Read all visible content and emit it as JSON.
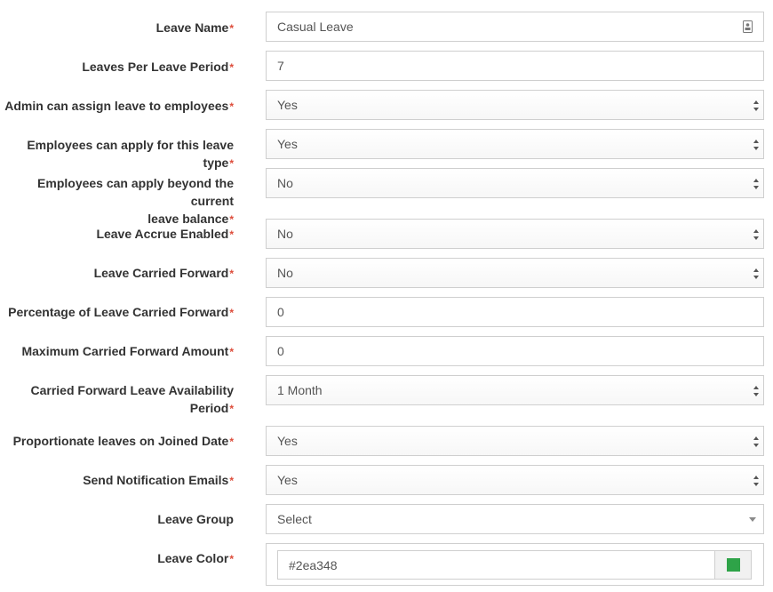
{
  "required_marker": "*",
  "fields": [
    {
      "label": "Leave Name",
      "value": "Casual Leave"
    },
    {
      "label": "Leaves Per Leave Period",
      "value": "7"
    },
    {
      "label": "Admin can assign leave to employees",
      "value": "Yes"
    },
    {
      "label": "Employees can apply for this leave type",
      "value": "Yes"
    },
    {
      "label_line1": "Employees can apply beyond the current",
      "label_line2": "leave balance",
      "value": "No"
    },
    {
      "label": "Leave Accrue Enabled",
      "value": "No"
    },
    {
      "label": "Leave Carried Forward",
      "value": "No"
    },
    {
      "label": "Percentage of Leave Carried Forward",
      "value": "0"
    },
    {
      "label": "Maximum Carried Forward Amount",
      "value": "0"
    },
    {
      "label_line1": "Carried Forward Leave Availability",
      "label_line2": "Period",
      "value": "1 Month"
    },
    {
      "label": "Proportionate leaves on Joined Date",
      "value": "Yes"
    },
    {
      "label": "Send Notification Emails",
      "value": "Yes"
    },
    {
      "label": "Leave Group",
      "value": "Select"
    },
    {
      "label": "Leave Color",
      "value": "#2ea348"
    }
  ],
  "colors": {
    "required": "#dd4b39",
    "leave_color_swatch": "#2ea348"
  },
  "icons": {
    "leave_name_field": "contact-card-icon",
    "select_arrows": "up-down-arrows-icon",
    "leave_group_dropdown": "caret-down-icon"
  }
}
